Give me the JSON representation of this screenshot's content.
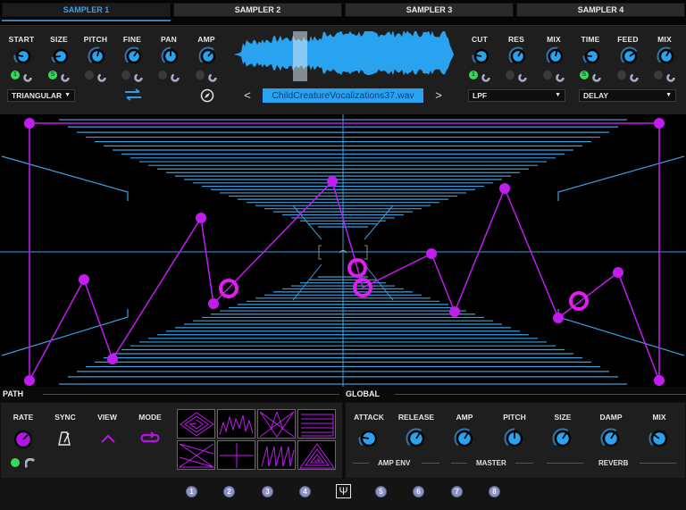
{
  "tabs": [
    {
      "label": "SAMPLER 1",
      "active": true
    },
    {
      "label": "SAMPLER 2",
      "active": false
    },
    {
      "label": "SAMPLER 3",
      "active": false
    },
    {
      "label": "SAMPLER 4",
      "active": false
    }
  ],
  "sampler": {
    "knobs": [
      {
        "label": "START",
        "value": 0.2,
        "mod_slot": "1",
        "mod_on": true
      },
      {
        "label": "SIZE",
        "value": 0.15,
        "mod_slot": "S",
        "mod_on": true
      },
      {
        "label": "PITCH",
        "value": 0.55,
        "mod_slot": "",
        "mod_on": false
      },
      {
        "label": "FINE",
        "value": 0.62,
        "mod_slot": "",
        "mod_on": false
      },
      {
        "label": "PAN",
        "value": 0.5,
        "mod_slot": "",
        "mod_on": false
      },
      {
        "label": "AMP",
        "value": 0.65,
        "mod_slot": "",
        "mod_on": false
      }
    ],
    "lfo_shape": "TRIANGULAR",
    "loop_icon": "swap-arrows-icon",
    "compass_icon": "compass-icon",
    "file_name": "ChildCreatureVocalizations37.wav",
    "prev_label": "<",
    "next_label": ">"
  },
  "filter": {
    "knobs": [
      {
        "label": "CUT",
        "value": 0.2,
        "mod_slot": "1",
        "mod_on": true
      },
      {
        "label": "RES",
        "value": 0.62,
        "mod_slot": "",
        "mod_on": false
      },
      {
        "label": "MIX",
        "value": 0.55,
        "mod_slot": "",
        "mod_on": false
      }
    ],
    "type": "LPF"
  },
  "fx": {
    "knobs": [
      {
        "label": "TIME",
        "value": 0.18,
        "mod_slot": "S",
        "mod_on": true
      },
      {
        "label": "FEED",
        "value": 0.7,
        "mod_slot": "",
        "mod_on": false
      },
      {
        "label": "MIX",
        "value": 0.6,
        "mod_slot": "",
        "mod_on": false
      }
    ],
    "type": "DELAY"
  },
  "visualizer": {
    "path_color": "#c21cf0",
    "grid_color": "#3a9fe0"
  },
  "path": {
    "title": "PATH",
    "labels": {
      "rate": "RATE",
      "sync": "SYNC",
      "view": "VIEW",
      "mode": "MODE"
    },
    "rate_mod_slot": "",
    "presets": [
      "diamond-spiral",
      "zigzag",
      "star-burst",
      "horizontal-lines",
      "bowtie",
      "crosshair",
      "diagonal-zigzag",
      "triangle-spiral"
    ]
  },
  "global": {
    "title": "GLOBAL",
    "knobs": [
      {
        "label": "ATTACK",
        "value": 0.2
      },
      {
        "label": "RELEASE",
        "value": 0.62
      },
      {
        "label": "AMP",
        "value": 0.62
      },
      {
        "label": "PITCH",
        "value": 0.5
      },
      {
        "label": "SIZE",
        "value": 0.62
      },
      {
        "label": "DAMP",
        "value": 0.62
      },
      {
        "label": "MIX",
        "value": 0.3
      }
    ],
    "groups": [
      "AMP ENV",
      "MASTER",
      "REVERB"
    ]
  },
  "footer": {
    "slots_left": [
      "1",
      "2",
      "3",
      "4"
    ],
    "center_icon": "Ψ",
    "slots_right": [
      "5",
      "6",
      "7",
      "8"
    ]
  }
}
